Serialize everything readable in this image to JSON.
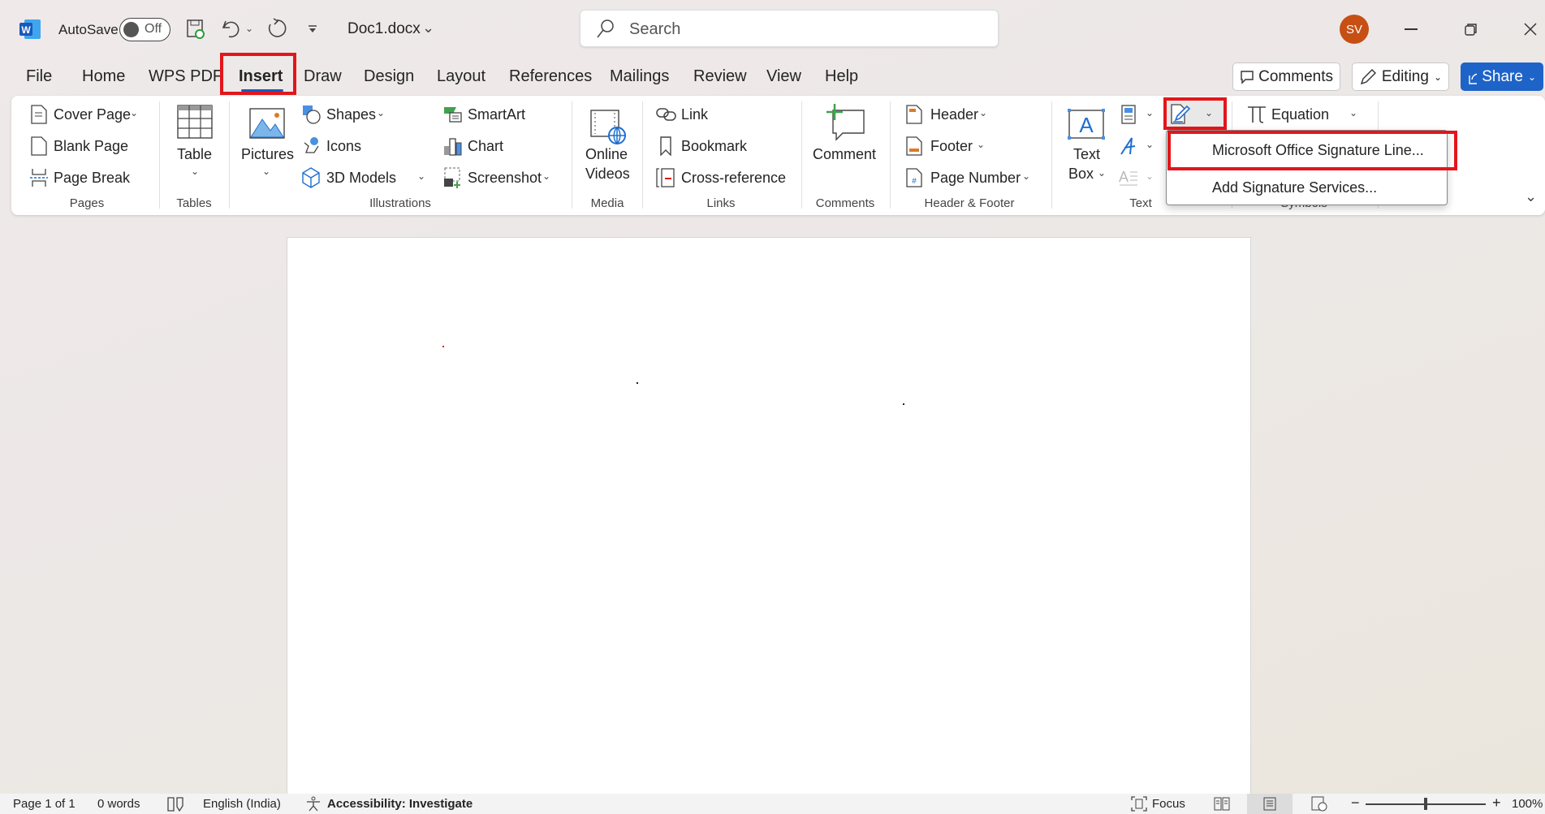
{
  "titlebar": {
    "autosave_label": "AutoSave",
    "autosave_state": "Off",
    "doc_name": "Doc1.docx",
    "search_placeholder": "Search",
    "avatar_initials": "SV",
    "avatar_color": "#c74f14"
  },
  "tabs": [
    {
      "label": "File"
    },
    {
      "label": "Home"
    },
    {
      "label": "WPS PDF"
    },
    {
      "label": "Insert",
      "active": true
    },
    {
      "label": "Draw"
    },
    {
      "label": "Design"
    },
    {
      "label": "Layout"
    },
    {
      "label": "References"
    },
    {
      "label": "Mailings"
    },
    {
      "label": "Review"
    },
    {
      "label": "View"
    },
    {
      "label": "Help"
    }
  ],
  "actions": {
    "comments": "Comments",
    "editing": "Editing",
    "share": "Share",
    "share_color": "#1e64c8"
  },
  "ribbon": {
    "pages": {
      "label": "Pages",
      "cover_page": "Cover Page",
      "blank_page": "Blank Page",
      "page_break": "Page Break"
    },
    "tables": {
      "label": "Tables",
      "table": "Table"
    },
    "illustrations": {
      "label": "Illustrations",
      "pictures": "Pictures",
      "shapes": "Shapes",
      "icons": "Icons",
      "models": "3D Models",
      "smartart": "SmartArt",
      "chart": "Chart",
      "screenshot": "Screenshot"
    },
    "media": {
      "label": "Media",
      "online": "Online",
      "videos": "Videos"
    },
    "links": {
      "label": "Links",
      "link": "Link",
      "bookmark": "Bookmark",
      "crossref": "Cross-reference"
    },
    "comments": {
      "label": "Comments",
      "comment": "Comment"
    },
    "header_footer": {
      "label": "Header & Footer",
      "header": "Header",
      "footer": "Footer",
      "page_number": "Page Number"
    },
    "text": {
      "label": "Text",
      "text": "Text",
      "box": "Box"
    },
    "symbols": {
      "label": "Symbols",
      "equation": "Equation"
    }
  },
  "signature_menu": {
    "items": [
      "Microsoft Office Signature Line...",
      "Add Signature Services..."
    ]
  },
  "statusbar": {
    "page": "Page 1 of 1",
    "words": "0 words",
    "language": "English (India)",
    "accessibility": "Accessibility: Investigate",
    "focus": "Focus",
    "zoom": "100%"
  },
  "highlight_color": "#e3161b"
}
